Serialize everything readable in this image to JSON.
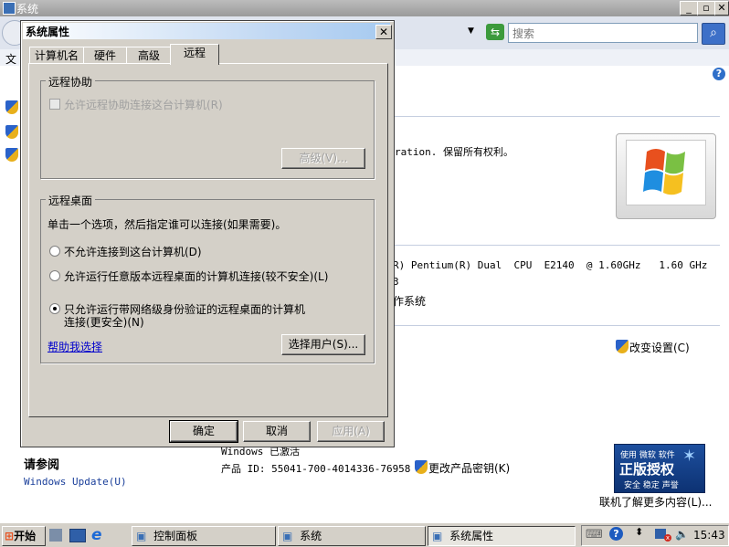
{
  "window": {
    "title": "系统",
    "search_placeholder": "搜索",
    "menu_first": "文",
    "help_glyph": "?",
    "copyright_fragment": "ration. 保留所有权利。",
    "cpu_text": "R) Pentium(R) Dual  CPU  E2140  @ 1.60GHz   1.60 GHz",
    "digit_fragment": "3",
    "os_fragment": "作系统",
    "change_settings": "改变设置(C)",
    "see_also_title": "请参阅",
    "windows_update": "Windows Update(U)",
    "activated_text": "Windows 已激活",
    "product_id": "产品 ID: 55041-700-4014336-76958",
    "change_key": "更改产品密钥(K)",
    "genuine_line1": "使用 微软 软件",
    "genuine_big": "正版授权",
    "genuine_line2": "安全 稳定 声誉",
    "learn_more": "联机了解更多内容(L)..."
  },
  "dialog": {
    "title": "系统属性",
    "tabs": [
      "计算机名",
      "硬件",
      "高级",
      "远程"
    ],
    "active_tab": "远程",
    "remote_assistance": {
      "legend": "远程协助",
      "allow_label": "允许远程协助连接这台计算机(R)",
      "advanced_button": "高级(V)..."
    },
    "remote_desktop": {
      "legend": "远程桌面",
      "instruction": "单击一个选项，然后指定谁可以连接(如果需要)。",
      "options": [
        "不允许连接到这台计算机(D)",
        "允许运行任意版本远程桌面的计算机连接(较不安全)(L)",
        "只允许运行带网络级身份验证的远程桌面的计算机连接(更安全)(N)"
      ],
      "option3_line1": "只允许运行带网络级身份验证的远程桌面的计算机",
      "option3_line2": "连接(更安全)(N)",
      "selected_option": 2,
      "help_link": "帮助我选择",
      "select_users_button": "选择用户(S)..."
    },
    "buttons": {
      "ok": "确定",
      "cancel": "取消",
      "apply": "应用(A)"
    }
  },
  "taskbar": {
    "start": "开始",
    "items": [
      "控制面板",
      "系统",
      "系统属性"
    ],
    "active_item": "系统属性",
    "clock": "15:43"
  }
}
